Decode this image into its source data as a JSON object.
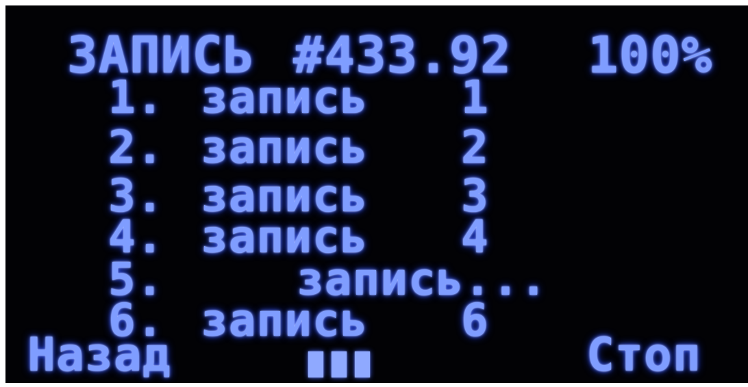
{
  "header": {
    "title": "ЗАПИСЬ",
    "frequency": "#433.92",
    "battery": "100%"
  },
  "records": [
    {
      "number": "1.",
      "label": "запись",
      "index": "1"
    },
    {
      "number": "2.",
      "label": "запись",
      "index": "2"
    },
    {
      "number": "3.",
      "label": "запись",
      "index": "3"
    },
    {
      "number": "4.",
      "label": "запись",
      "index": "4"
    },
    {
      "number": "5.",
      "label": "запись...",
      "index": ""
    },
    {
      "number": "6.",
      "label": "запись",
      "index": "6"
    }
  ],
  "footer": {
    "back_label": "Назад",
    "stop_label": "Стоп",
    "progress_icon": "three-bars-icon"
  },
  "colors": {
    "background": "#020205",
    "text": "#7f9dff"
  }
}
